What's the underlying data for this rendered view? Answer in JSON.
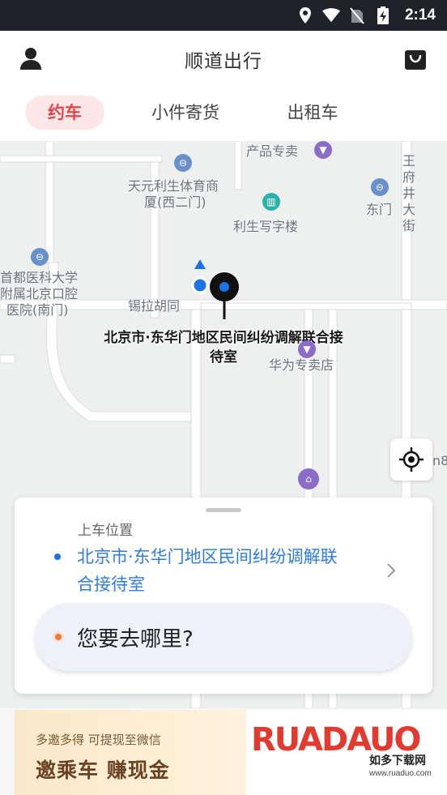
{
  "status_bar": {
    "time": "2:14",
    "icons": [
      "location-icon",
      "wifi-icon",
      "no-sim-icon",
      "battery-charging-icon"
    ]
  },
  "header": {
    "title": "顺道出行",
    "left_icon": "user-icon",
    "right_icon": "bag-icon"
  },
  "tabs": [
    {
      "label": "约车",
      "active": true
    },
    {
      "label": "小件寄货",
      "active": false
    },
    {
      "label": "出租车",
      "active": false
    }
  ],
  "map": {
    "labels": {
      "product_store": "产品专卖",
      "tianyuan_1": "天元利生体育商",
      "tianyuan_2": "厦(西二门)",
      "lisheng": "利生写字楼",
      "dongmen": "东门",
      "wangfujing": [
        "王",
        "府",
        "井",
        "大",
        "街"
      ],
      "hospital_1": "首都医科大学",
      "hospital_2": "附属北京口腔",
      "hospital_3": "医院(南门)",
      "xila": "锡拉胡同",
      "huawei": "华为专卖店",
      "edge_n8": "n8"
    },
    "pin_address_line1": "北京市·东华门地区民间纠纷调解联合接",
    "pin_address_line2": "待室",
    "accent_color": "#1a73e8"
  },
  "pickup": {
    "title": "上车位置",
    "address_line1": "北京市·东华门地区民间纠纷调解联",
    "address_line2": "合接待室"
  },
  "destination": {
    "placeholder": "您要去哪里?"
  },
  "banner": {
    "small_text": "多邀多得 可提现至微信",
    "big_text": "邀乘车 赚现金",
    "watermark_letters": "RUADAUO",
    "watermark_sub": "如多下载网",
    "watermark_url": "www.ruaduo.com"
  }
}
